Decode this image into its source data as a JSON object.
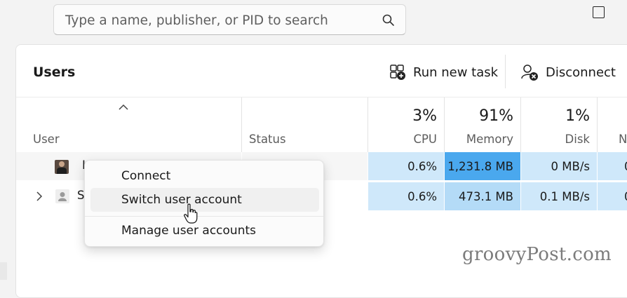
{
  "search": {
    "placeholder": "Type a name, publisher, or PID to search"
  },
  "header": {
    "title": "Users",
    "run_new_task": "Run new task",
    "disconnect": "Disconnect"
  },
  "columns": {
    "user": "User",
    "status": "Status",
    "cpu": {
      "label": "CPU",
      "percent": "3%"
    },
    "memory": {
      "label": "Memory",
      "percent": "91%"
    },
    "disk": {
      "label": "Disk",
      "percent": "1%"
    },
    "network_partial": {
      "label": "N"
    }
  },
  "rows": [
    {
      "user_initial": "I",
      "cpu": "0.6%",
      "memory": "1,231.8 MB",
      "disk": "0 MB/s",
      "network_partial": "0"
    },
    {
      "user_initial": "S",
      "cpu": "0.6%",
      "memory": "473.1 MB",
      "disk": "0.1 MB/s",
      "network_partial": "0"
    }
  ],
  "context_menu": {
    "items": [
      "Connect",
      "Switch user account",
      "Manage user accounts"
    ],
    "hovered": "Switch user account"
  },
  "watermark": "groovyPost.com",
  "colors": {
    "heat_light": "#cfe8fa",
    "heat_medium": "#b4dbf7",
    "heat_strong": "#4aa8ee",
    "panel_bg": "#ffffff",
    "window_bg": "#f3f3f3"
  }
}
